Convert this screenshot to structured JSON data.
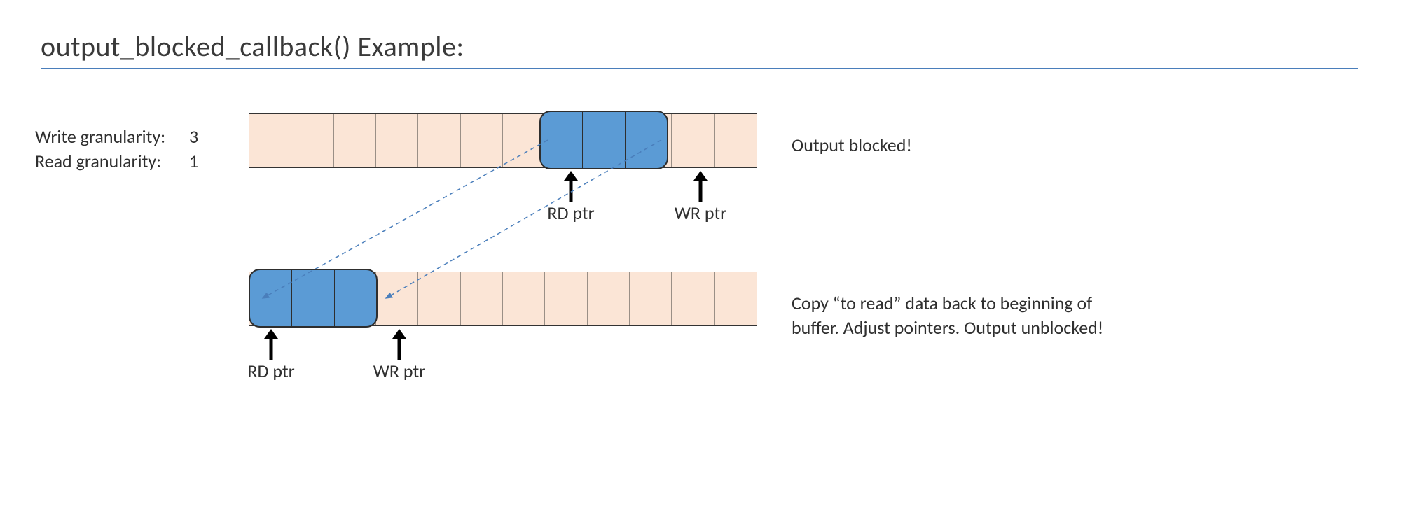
{
  "title": "output_blocked_callback() Example:",
  "granularity": {
    "write_label": "Write granularity:",
    "write_value": "3",
    "read_label": "Read granularity:",
    "read_value": "1"
  },
  "buffer": {
    "cells": 12,
    "data_span": 3,
    "before": {
      "rd_ptr_label": "RD ptr",
      "wr_ptr_label": "WR ptr",
      "rd_index": 7,
      "wr_index": 10
    },
    "after": {
      "rd_ptr_label": "RD ptr",
      "wr_ptr_label": "WR ptr",
      "rd_index": 0,
      "wr_index": 3
    }
  },
  "captions": {
    "blocked": "Output blocked!",
    "unblocked": "Copy “to read” data back to beginning of buffer. Adjust pointers. Output unblocked!"
  },
  "colors": {
    "buffer_fill": "#fbe5d6",
    "data_fill": "#5b9bd5",
    "rule": "#4a7ebb"
  }
}
